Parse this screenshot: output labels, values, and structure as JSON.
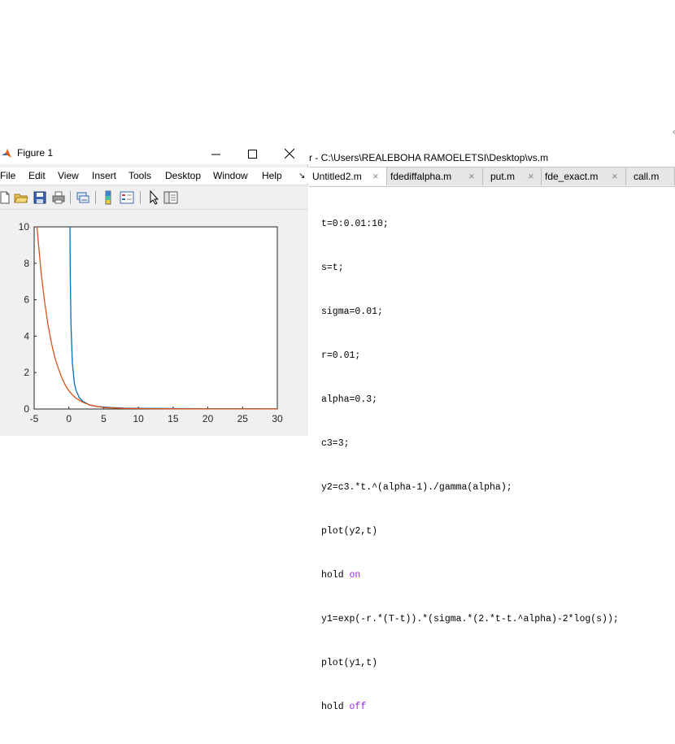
{
  "figure": {
    "title": "Figure 1",
    "menu": [
      "File",
      "Edit",
      "View",
      "Insert",
      "Tools",
      "Desktop",
      "Window",
      "Help"
    ],
    "menu_overflow": "↘",
    "toolbar_icons": [
      "new-figure-icon",
      "open-file-icon",
      "save-icon",
      "print-icon",
      "link-plot-icon",
      "colorbar-icon",
      "legend-icon",
      "pointer-icon",
      "property-editor-icon"
    ]
  },
  "editor": {
    "title": "r - C:\\Users\\REALEBOHA RAMOELETSI\\Desktop\\vs.m",
    "tabs": [
      "Untitled2.m",
      "fdediffalpha.m",
      "put.m",
      "fde_exact.m",
      "call.m"
    ],
    "close_glyph": "×",
    "code": [
      {
        "text": "t=0:0.01:10;",
        "kw": ""
      },
      {
        "text": "s=t;",
        "kw": ""
      },
      {
        "text": "sigma=0.01;",
        "kw": ""
      },
      {
        "text": "r=0.01;",
        "kw": ""
      },
      {
        "text": "alpha=0.3;",
        "kw": ""
      },
      {
        "text": "c3=3;",
        "kw": ""
      },
      {
        "text": "y2=c3.*t.^(alpha-1)./gamma(alpha);",
        "kw": ""
      },
      {
        "text": "plot(y2,t)",
        "kw": ""
      },
      {
        "text": "hold ",
        "kw": "on"
      },
      {
        "text": "y1=exp(-r.*(T-t)).*(sigma.*(2.*t-t.^alpha)-2*log(s));",
        "kw": ""
      },
      {
        "text": "plot(y1,t)",
        "kw": ""
      },
      {
        "text": "hold ",
        "kw": "off"
      }
    ]
  },
  "chart_data": {
    "type": "line",
    "xlim": [
      -5,
      30
    ],
    "ylim": [
      0,
      10
    ],
    "xticks": [
      "-5",
      "0",
      "5",
      "10",
      "15",
      "20",
      "25",
      "30"
    ],
    "yticks": [
      "0",
      "2",
      "4",
      "6",
      "8",
      "10"
    ],
    "grid": false,
    "series": [
      {
        "color": "#0072BD",
        "x": [
          0.15,
          0.2,
          0.3,
          0.5,
          0.8,
          1.0,
          1.5,
          2,
          3,
          4,
          6,
          8,
          10,
          15,
          20,
          25,
          30
        ],
        "y": [
          10,
          7.3,
          4.6,
          2.5,
          1.4,
          1.05,
          0.62,
          0.42,
          0.22,
          0.14,
          0.08,
          0.05,
          0.04,
          0.025,
          0.018,
          0.013,
          0.01
        ]
      },
      {
        "color": "#D95319",
        "x": [
          -4.6,
          -4.0,
          -3.5,
          -3.0,
          -2.5,
          -2.0,
          -1.5,
          -1.0,
          -0.5,
          0.0,
          0.5,
          1.0,
          2.0,
          3.0,
          5.0,
          8.0,
          12.0,
          18.0,
          25.0,
          30.0
        ],
        "y": [
          10,
          7.5,
          5.9,
          4.6,
          3.6,
          2.8,
          2.2,
          1.7,
          1.3,
          1.0,
          0.78,
          0.6,
          0.37,
          0.22,
          0.08,
          0.03,
          0.015,
          0.008,
          0.005,
          0.004
        ]
      }
    ]
  },
  "misc": {
    "right_mark": "‹"
  }
}
